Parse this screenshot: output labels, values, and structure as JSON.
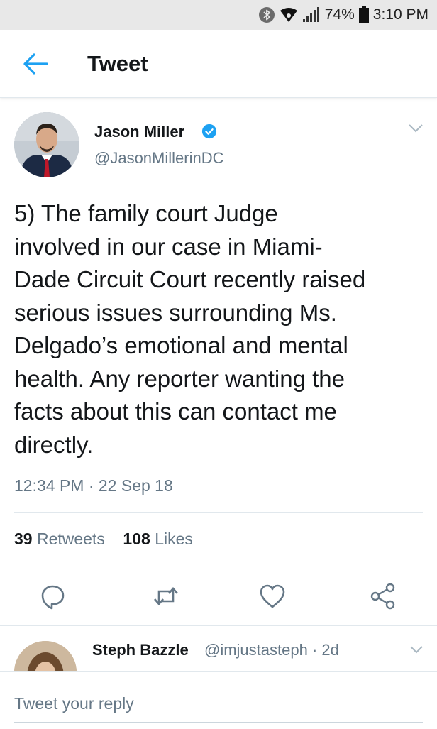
{
  "status_bar": {
    "battery_percent": "74%",
    "time": "3:10 PM",
    "icons": [
      "bluetooth-icon",
      "wifi-icon",
      "signal-icon",
      "battery-icon"
    ]
  },
  "app_bar": {
    "title": "Tweet",
    "back_icon": "arrow-left-icon"
  },
  "tweet": {
    "author_name": "Jason Miller",
    "author_handle": "@JasonMillerinDC",
    "verified": true,
    "text_lines": [
      "5) The family court Judge",
      "involved in our case in Miami-",
      "Dade Circuit Court recently raised",
      "serious issues surrounding Ms.",
      "Delgado’s emotional and mental",
      "health. Any reporter wanting the",
      "facts about this can contact me",
      "directly."
    ],
    "timestamp": "12:34 PM · 22 Sep 18",
    "retweets_count": "39",
    "retweets_label": "Retweets",
    "likes_count": "108",
    "likes_label": "Likes",
    "actions": [
      "reply-icon",
      "retweet-icon",
      "like-icon",
      "share-icon"
    ]
  },
  "reply": {
    "author_name": "Steph Bazzle",
    "author_handle": "@imjustasteph · 2d"
  },
  "reply_box": {
    "placeholder": "Tweet your reply"
  },
  "colors": {
    "accent": "#1da1f2",
    "secondary_text": "#657786",
    "primary_text": "#14171a",
    "divider": "#e1e8ed"
  }
}
